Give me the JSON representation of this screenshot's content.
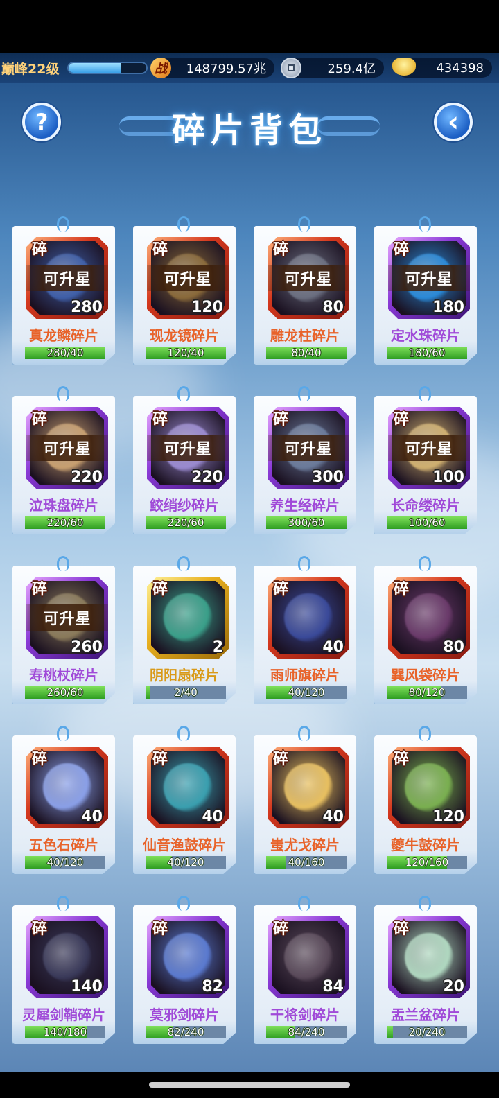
{
  "status": {
    "level_label": "巅峰22级",
    "xp_progress": 0.68,
    "combat_icon": "战",
    "combat_power": "148799.57兆",
    "silver": "259.4亿",
    "gold": "434398"
  },
  "header": {
    "title": "碎片背包",
    "help_icon": "?",
    "back_icon": "‹"
  },
  "badge_label": "碎",
  "upgrade_label": "可升星",
  "colors": {
    "red": "#d4381e",
    "purple": "#8a3ad6",
    "gold": "#e8b020",
    "bar_fill": "#2f9e22"
  },
  "items": [
    {
      "name": "真龙鳞碎片",
      "count": "280",
      "progress": "280/40",
      "ratio": 1.0,
      "rarity": "red",
      "upgrade": true,
      "art": "#3f5fa8"
    },
    {
      "name": "现龙镜碎片",
      "count": "120",
      "progress": "120/40",
      "ratio": 1.0,
      "rarity": "red",
      "upgrade": true,
      "art": "#8a6a3a"
    },
    {
      "name": "雕龙柱碎片",
      "count": "80",
      "progress": "80/40",
      "ratio": 1.0,
      "rarity": "red",
      "upgrade": true,
      "art": "#6b6f80"
    },
    {
      "name": "定水珠碎片",
      "count": "180",
      "progress": "180/60",
      "ratio": 1.0,
      "rarity": "purple",
      "upgrade": true,
      "art": "#2a8ad8"
    },
    {
      "name": "泣珠盘碎片",
      "count": "220",
      "progress": "220/60",
      "ratio": 1.0,
      "rarity": "purple",
      "upgrade": true,
      "art": "#c8a070"
    },
    {
      "name": "鲛绡纱碎片",
      "count": "220",
      "progress": "220/60",
      "ratio": 1.0,
      "rarity": "purple",
      "upgrade": true,
      "art": "#9a8ad0"
    },
    {
      "name": "养生经碎片",
      "count": "300",
      "progress": "300/60",
      "ratio": 1.0,
      "rarity": "purple",
      "upgrade": true,
      "art": "#6a7a9a"
    },
    {
      "name": "长命缕碎片",
      "count": "100",
      "progress": "100/60",
      "ratio": 1.0,
      "rarity": "purple",
      "upgrade": true,
      "art": "#d0b070"
    },
    {
      "name": "寿桃杖碎片",
      "count": "260",
      "progress": "260/60",
      "ratio": 1.0,
      "rarity": "purple",
      "upgrade": true,
      "art": "#8a7a5a"
    },
    {
      "name": "阴阳扇碎片",
      "count": "2",
      "progress": "2/40",
      "ratio": 0.05,
      "rarity": "gold",
      "upgrade": false,
      "art": "#3aa08a"
    },
    {
      "name": "雨师旗碎片",
      "count": "40",
      "progress": "40/120",
      "ratio": 0.33,
      "rarity": "red",
      "upgrade": false,
      "art": "#3a4a9a"
    },
    {
      "name": "巽风袋碎片",
      "count": "80",
      "progress": "80/120",
      "ratio": 0.67,
      "rarity": "red",
      "upgrade": false,
      "art": "#6a3a6a"
    },
    {
      "name": "五色石碎片",
      "count": "40",
      "progress": "40/120",
      "ratio": 0.33,
      "rarity": "red",
      "upgrade": false,
      "art": "#8aa0e8"
    },
    {
      "name": "仙音渔鼓碎片",
      "count": "40",
      "progress": "40/120",
      "ratio": 0.33,
      "rarity": "red",
      "upgrade": false,
      "art": "#3aa0b0"
    },
    {
      "name": "蚩尤戈碎片",
      "count": "40",
      "progress": "40/160",
      "ratio": 0.25,
      "rarity": "red",
      "upgrade": false,
      "art": "#e8c060"
    },
    {
      "name": "夔牛鼓碎片",
      "count": "120",
      "progress": "120/160",
      "ratio": 0.75,
      "rarity": "red",
      "upgrade": false,
      "art": "#7ab050"
    },
    {
      "name": "灵犀剑鞘碎片",
      "count": "140",
      "progress": "140/180",
      "ratio": 0.78,
      "rarity": "purple",
      "upgrade": false,
      "art": "#3a3a5a"
    },
    {
      "name": "莫邪剑碎片",
      "count": "82",
      "progress": "82/240",
      "ratio": 0.34,
      "rarity": "purple",
      "upgrade": false,
      "art": "#5a7ad0"
    },
    {
      "name": "干将剑碎片",
      "count": "84",
      "progress": "84/240",
      "ratio": 0.35,
      "rarity": "purple",
      "upgrade": false,
      "art": "#5a4a5a"
    },
    {
      "name": "盂兰盆碎片",
      "count": "20",
      "progress": "20/240",
      "ratio": 0.08,
      "rarity": "purple",
      "upgrade": false,
      "art": "#b0d8c0"
    }
  ]
}
